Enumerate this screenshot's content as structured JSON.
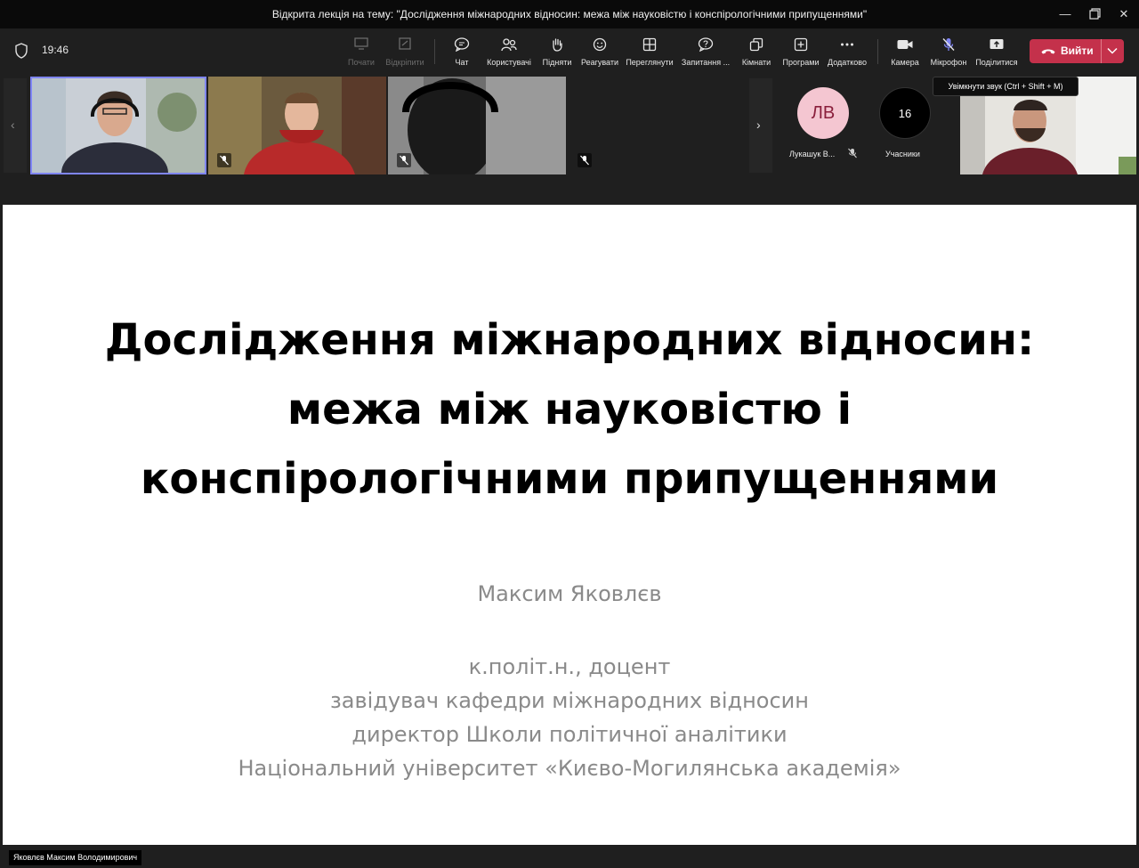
{
  "window": {
    "title": "Відкрита лекція на тему: \"Дослідження міжнародних відносин: межа між науковістю і конспірологічними припущеннями\"",
    "minimize_icon": "minimize-icon",
    "restore_icon": "restore-icon",
    "close_icon": "close-icon"
  },
  "toolbar": {
    "time": "19:46",
    "buttons": [
      {
        "id": "start",
        "label": "Почати",
        "icon": "start-icon"
      },
      {
        "id": "pin",
        "label": "Відкріпити",
        "icon": "unpin-icon"
      },
      {
        "id": "chat",
        "label": "Чат",
        "icon": "chat-icon"
      },
      {
        "id": "people",
        "label": "Користувачі",
        "icon": "people-icon"
      },
      {
        "id": "raise",
        "label": "Підняти",
        "icon": "hand-icon"
      },
      {
        "id": "react",
        "label": "Реагувати",
        "icon": "smile-icon"
      },
      {
        "id": "view",
        "label": "Переглянути",
        "icon": "grid-icon"
      },
      {
        "id": "qa",
        "label": "Запитання ...",
        "icon": "question-icon"
      },
      {
        "id": "rooms",
        "label": "Кімнати",
        "icon": "rooms-icon"
      },
      {
        "id": "apps",
        "label": "Програми",
        "icon": "apps-icon"
      },
      {
        "id": "more",
        "label": "Додатково",
        "icon": "more-icon"
      },
      {
        "id": "camera",
        "label": "Камера",
        "icon": "camera-icon"
      },
      {
        "id": "mic",
        "label": "Мікрофон",
        "icon": "mic-off-icon"
      },
      {
        "id": "share",
        "label": "Поділитися",
        "icon": "share-icon"
      }
    ],
    "leave_label": "Вийти"
  },
  "tooltip": {
    "text": "Увімкнути звук (Ctrl + Shift + M)"
  },
  "participants": {
    "lv_initials": "ЛВ",
    "lv_name": "Лукашук В...",
    "count": "16",
    "count_label": "Учасники"
  },
  "slide": {
    "title_lines": [
      "Дослідження міжнародних відносин:",
      "межа між науковістю і",
      "конспірологічними припущеннями"
    ],
    "author": "Максим Яковлєв",
    "affiliation": [
      "к.політ.н., доцент",
      "завідувач кафедри міжнародних відносин",
      "директор Школи політичної аналітики",
      "Національний університет «Києво-Могилянська академія»"
    ]
  },
  "presenter": {
    "name": "Яковлєв Максим Володимирович"
  },
  "colors": {
    "accent": "#7f85f5",
    "leave": "#c4314b",
    "avatar_bg": "#f4c6d1"
  }
}
